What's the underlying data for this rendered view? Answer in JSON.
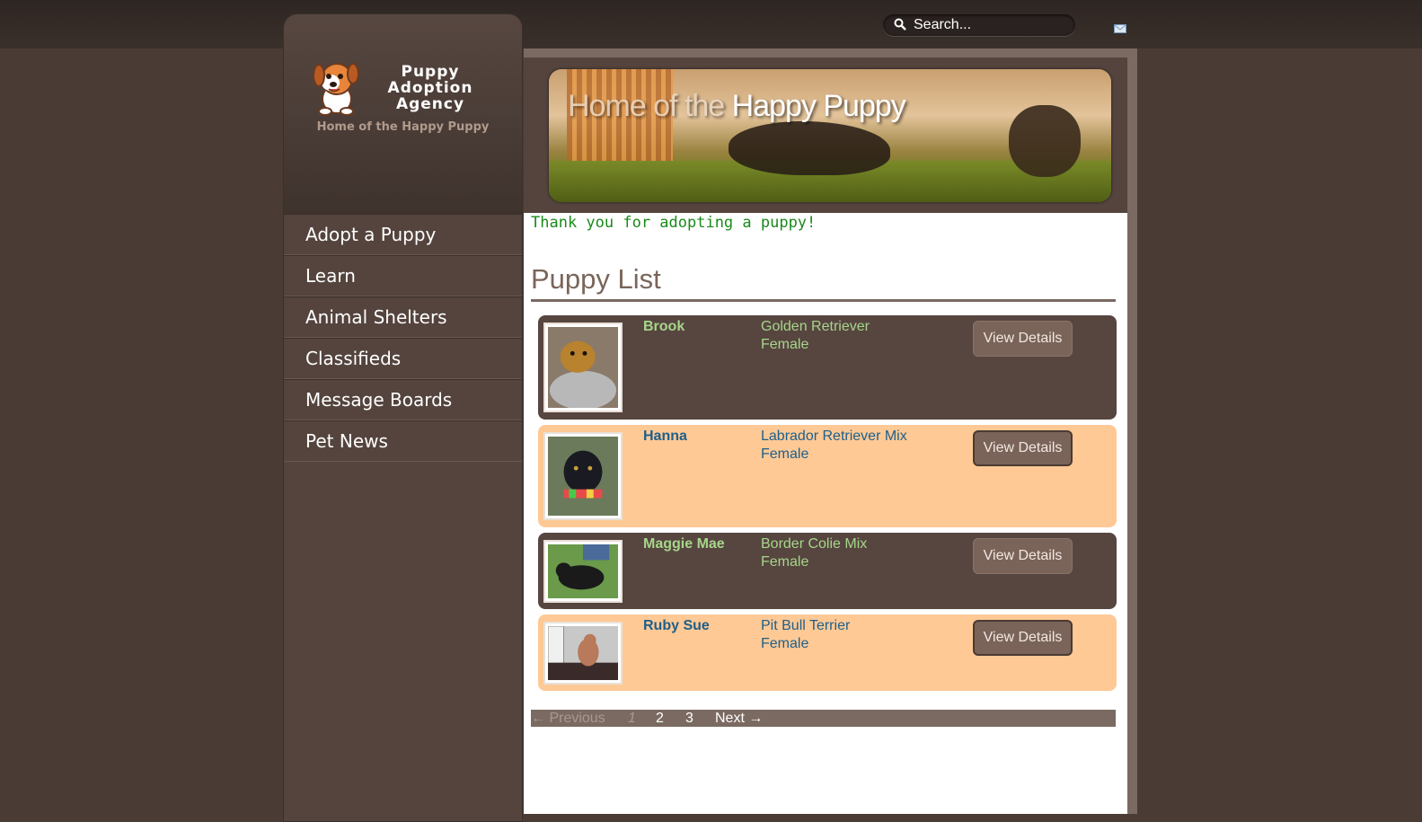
{
  "search": {
    "placeholder": "Search..."
  },
  "header_icons": [
    "search-icon",
    "mail-icon"
  ],
  "logo": {
    "line1": "Puppy",
    "line2": "Adoption",
    "line3": "Agency",
    "tagline": "Home of the Happy Puppy"
  },
  "nav": {
    "items": [
      {
        "label": "Adopt a Puppy"
      },
      {
        "label": "Learn"
      },
      {
        "label": "Animal Shelters"
      },
      {
        "label": "Classifieds"
      },
      {
        "label": "Message Boards"
      },
      {
        "label": "Pet News"
      }
    ]
  },
  "banner": {
    "title_part1": "Home of the ",
    "title_part2": "Happy Puppy"
  },
  "main": {
    "notice": "Thank you for adopting a puppy!",
    "heading": "Puppy List"
  },
  "puppies": [
    {
      "name": "Brook",
      "breed": "Golden Retriever",
      "sex": "Female",
      "button": "View Details"
    },
    {
      "name": "Hanna",
      "breed": "Labrador Retriever Mix",
      "sex": "Female",
      "button": "View Details"
    },
    {
      "name": "Maggie Mae",
      "breed": "Border Colie Mix",
      "sex": "Female",
      "button": "View Details"
    },
    {
      "name": "Ruby Sue",
      "breed": "Pit Bull Terrier",
      "sex": "Female",
      "button": "View Details"
    }
  ],
  "pager": {
    "previous": "← Previous",
    "current": "1",
    "page2": "2",
    "page3": "3",
    "next": "Next →"
  },
  "colors": {
    "background": "#4a3c35",
    "sidebar": "#54443d",
    "notice_green": "#1a8a1a",
    "row_dark": "#574540",
    "row_light": "#ffc995",
    "name_green": "#a6d68a",
    "name_blue": "#1e5f8a"
  }
}
